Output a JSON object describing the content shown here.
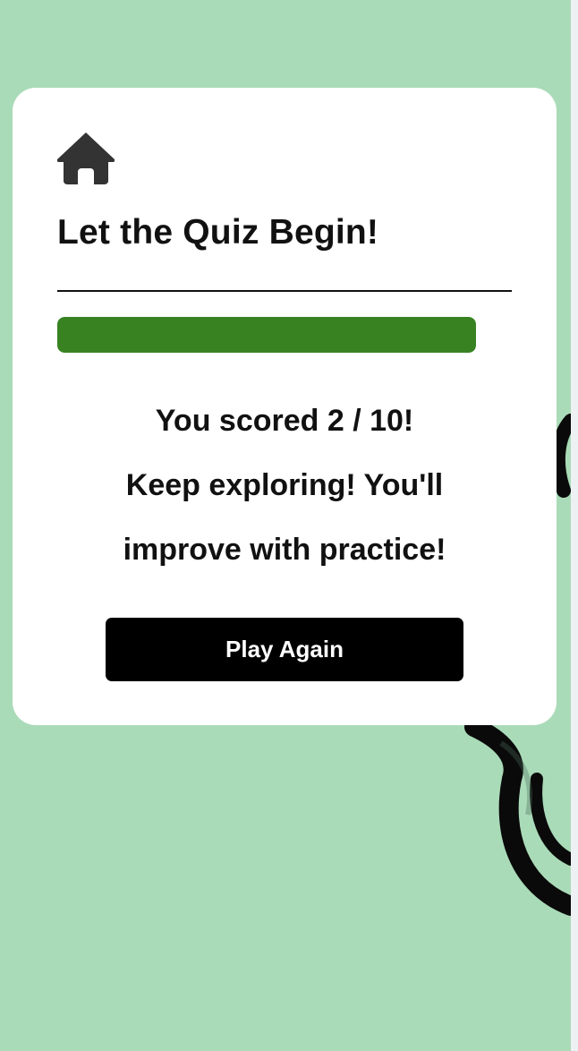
{
  "colors": {
    "page_background": "#aadbb8",
    "card_background": "#ffffff",
    "progress_fill": "#388222",
    "button_background": "#000000",
    "button_text": "#ffffff",
    "text": "#111111"
  },
  "header": {
    "home_icon": "home-icon",
    "title": "Let the Quiz Begin!"
  },
  "progress": {
    "fraction": 1.0
  },
  "result": {
    "score_text": "You scored 2 / 10!",
    "message": "Keep exploring! You'll improve with practice!"
  },
  "actions": {
    "play_again_label": "Play Again"
  }
}
